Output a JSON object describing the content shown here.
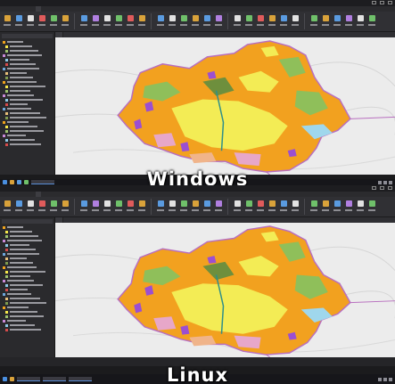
{
  "comparison_labels": {
    "top": "Windows",
    "bottom": "Linux"
  },
  "app": {
    "menu": [
      "",
      "",
      "",
      "",
      "",
      "",
      "",
      ""
    ],
    "ribbon_icon_colors": [
      "#d9a23a",
      "#5a9be0",
      "#e2e2e2",
      "#e05b5b",
      "#6fc06a",
      "#d9a23a",
      "#5a9be0",
      "#b07fe0",
      "#e2e2e2",
      "#6fc06a",
      "#e05b5b",
      "#d9a23a",
      "#5a9be0",
      "#e2e2e2",
      "#6fc06a",
      "#d9a23a",
      "#5a9be0",
      "#b07fe0",
      "#e2e2e2",
      "#6fc06a",
      "#e05b5b",
      "#d9a23a",
      "#5a9be0",
      "#e2e2e2",
      "#6fc06a",
      "#d9a23a",
      "#5a9be0",
      "#b07fe0",
      "#e2e2e2",
      "#6fc06a"
    ],
    "layer_colors": [
      "#f0a31c",
      "#f6e84a",
      "#9dc26d",
      "#c98ad9",
      "#8ec9e6",
      "#d64b4b",
      "#6fa8dc",
      "#e8c07a",
      "#7f9b4f",
      "#f0a31c",
      "#f6e84a",
      "#9dc26d",
      "#c98ad9",
      "#8ec9e6",
      "#d64b4b",
      "#6fa8dc",
      "#e8c07a",
      "#7f9b4f",
      "#f0a31c",
      "#f6e84a",
      "#9dc26d",
      "#c98ad9",
      "#8ec9e6",
      "#d64b4b"
    ]
  },
  "map_colors": {
    "orange": "#f2a11f",
    "yellow": "#f3ec55",
    "green": "#8fbf5a",
    "olive": "#6e8f3d",
    "purple": "#9b4fd1",
    "pink": "#e7a7c9",
    "cyan": "#9fd7ec",
    "salmon": "#f0b48a",
    "teal": "#2f8f8a",
    "boundary": "#b86fbf"
  }
}
